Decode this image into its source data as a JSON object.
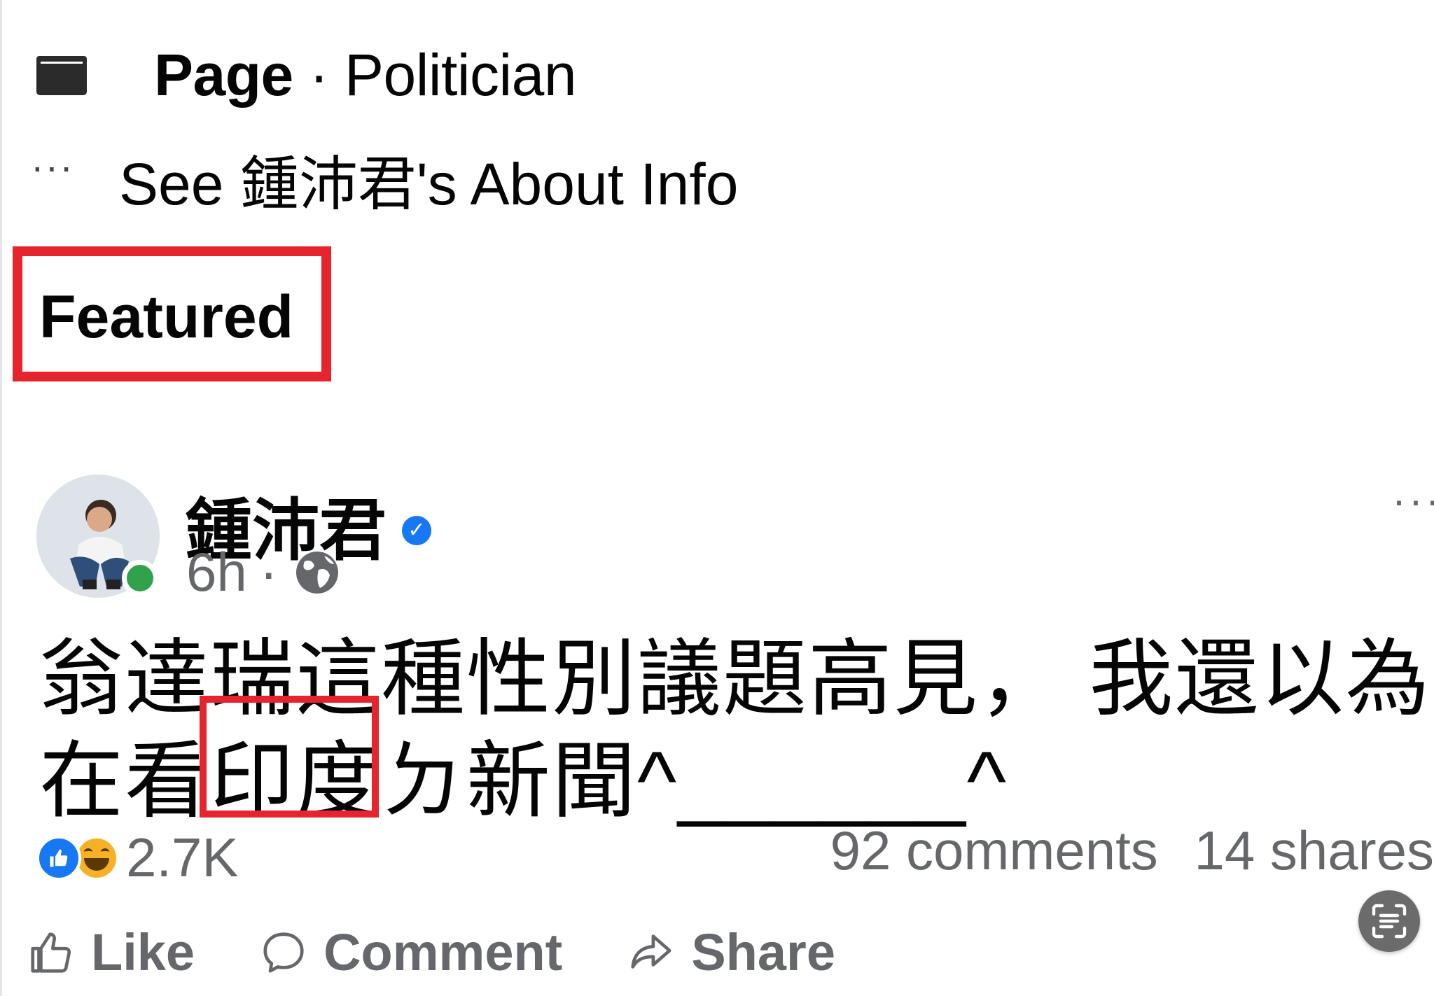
{
  "intro": {
    "page_label": "Page",
    "separator": "·",
    "category": "Politician",
    "about_link": "See 鍾沛君's About Info",
    "more_icon": "ellipsis-icon",
    "page_icon": "folder-icon"
  },
  "featured": {
    "title": "Featured",
    "highlight_color": "#e6242d"
  },
  "post": {
    "author": "鍾沛君",
    "verified_icon": "verified-badge-icon",
    "time": "6h",
    "meta_separator": "·",
    "audience_icon": "globe-icon",
    "more_icon": "more-options-icon",
    "text_line1": "翁達瑞這種性別議題高見， 我還以為",
    "text_line2_before": "在看",
    "text_line2_highlight": "印度",
    "text_line2_after": "ㄉ新聞^______^",
    "reactions_count": "2.7K",
    "reaction_icons": [
      "like-reaction-icon",
      "haha-reaction-icon"
    ],
    "comments": "92 comments",
    "shares": "14 shares"
  },
  "actions": {
    "like": "Like",
    "comment": "Comment",
    "share": "Share"
  },
  "colors": {
    "link_blue": "#1877f2",
    "online_green": "#31a24c",
    "secondary_text": "#65676b"
  }
}
